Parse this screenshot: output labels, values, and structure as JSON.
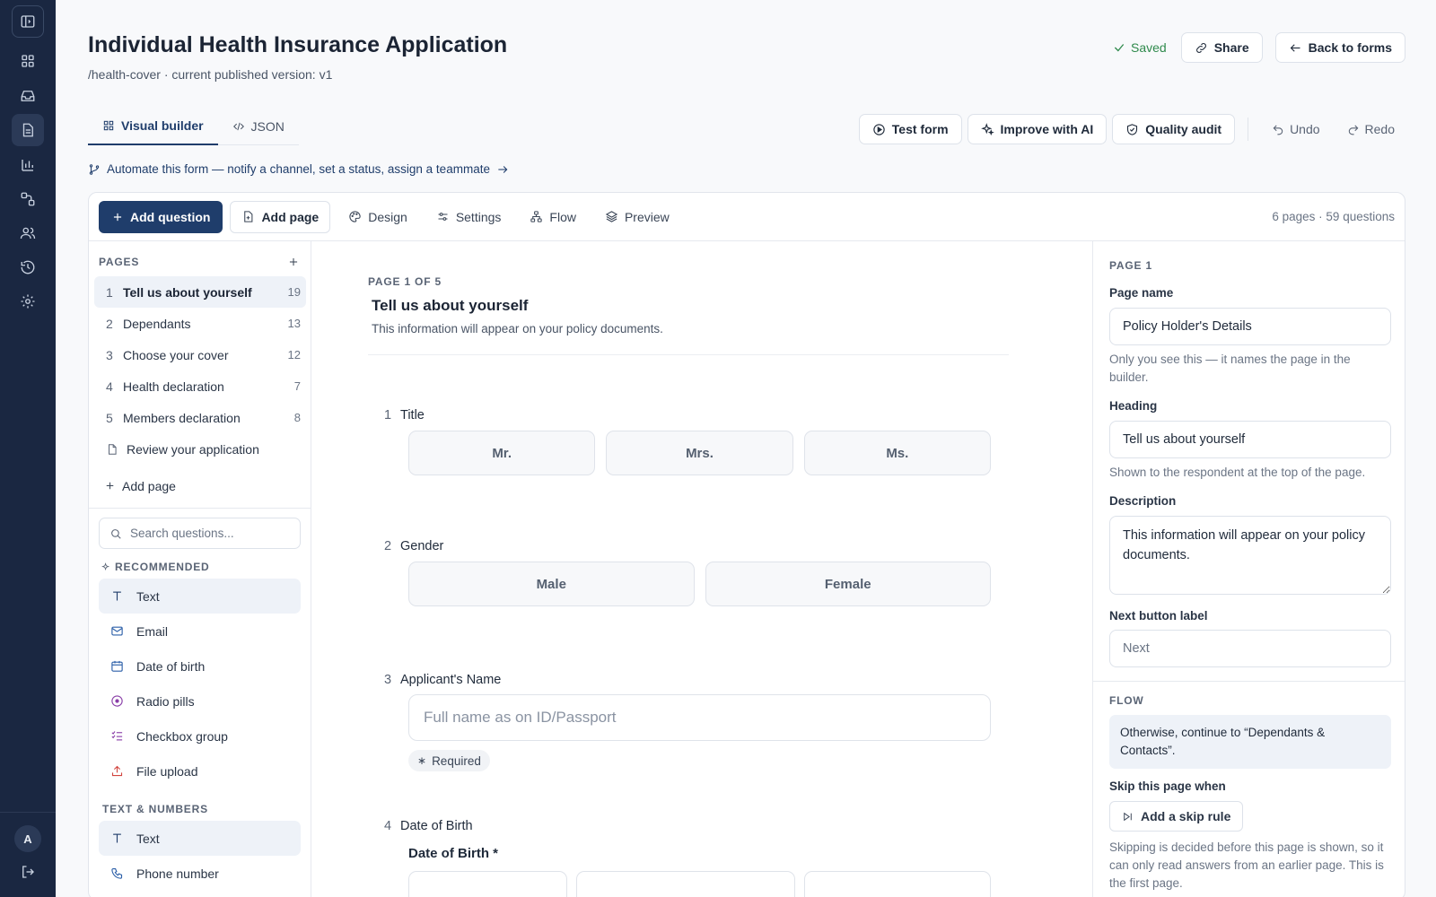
{
  "app": {
    "title": "Individual Health Insurance Application",
    "subtitle": "/health-cover · current published version: v1",
    "saved_label": "Saved",
    "share_label": "Share",
    "back_label": "Back to forms"
  },
  "rail": {
    "avatar": "A",
    "items": [
      "sidebar-toggle-icon",
      "grid-icon",
      "inbox-icon",
      "document-icon",
      "bar-chart-icon",
      "workflow-icon",
      "users-icon",
      "history-icon",
      "gear-icon"
    ],
    "active": "document-icon"
  },
  "tabs": [
    {
      "label": "Visual builder",
      "active": true
    },
    {
      "label": "JSON",
      "active": false
    }
  ],
  "actions": {
    "test_form": "Test form",
    "improve_ai": "Improve with AI",
    "quality_audit": "Quality audit",
    "undo": "Undo",
    "redo": "Redo"
  },
  "automate_link": "Automate this form — notify a channel, set a status, assign a teammate",
  "toolbar": {
    "add_question": "Add question",
    "add_page": "Add page",
    "design": "Design",
    "settings": "Settings",
    "flow": "Flow",
    "preview": "Preview",
    "summary": "6 pages · 59 questions"
  },
  "pages_panel": {
    "label": "PAGES",
    "items": [
      {
        "num": "1",
        "name": "Tell us about yourself",
        "count": "19",
        "active": true
      },
      {
        "num": "2",
        "name": "Dependants",
        "count": "13"
      },
      {
        "num": "3",
        "name": "Choose your cover",
        "count": "12"
      },
      {
        "num": "4",
        "name": "Health declaration",
        "count": "7"
      },
      {
        "num": "5",
        "name": "Members declaration",
        "count": "8"
      }
    ],
    "review_item": "Review your application",
    "add_page": "Add page"
  },
  "question_types": {
    "search_placeholder": "Search questions...",
    "recommended_label": "RECOMMENDED",
    "recommended": [
      "Text",
      "Email",
      "Date of birth",
      "Radio pills",
      "Checkbox group",
      "File upload"
    ],
    "text_numbers_label": "TEXT & NUMBERS",
    "text_numbers": [
      "Text",
      "Phone number"
    ]
  },
  "canvas": {
    "page_of": "PAGE 1 OF 5",
    "page_title": "Tell us about yourself",
    "page_desc": "This information will appear on your policy documents.",
    "questions": [
      {
        "num": "1",
        "label": "Title",
        "options": [
          "Mr.",
          "Mrs.",
          "Ms."
        ]
      },
      {
        "num": "2",
        "label": "Gender",
        "options": [
          "Male",
          "Female"
        ]
      },
      {
        "num": "3",
        "label": "Applicant's Name",
        "placeholder": "Full name as on ID/Passport",
        "badge": "Required"
      },
      {
        "num": "4",
        "label": "Date of Birth",
        "sub_label": "Date of Birth *"
      }
    ]
  },
  "props": {
    "section": "PAGE 1",
    "page_name_label": "Page name",
    "page_name_value": "Policy Holder's Details",
    "page_name_help": "Only you see this — it names the page in the builder.",
    "heading_label": "Heading",
    "heading_value": "Tell us about yourself",
    "heading_help": "Shown to the respondent at the top of the page.",
    "description_label": "Description",
    "description_value": "This information will appear on your policy documents.",
    "next_label": "Next button label",
    "next_placeholder": "Next",
    "flow_section": "FLOW",
    "flow_note": "Otherwise, continue to “Dependants & Contacts”.",
    "skip_label": "Skip this page when",
    "skip_button": "Add a skip rule",
    "skip_help": "Skipping is decided before this page is shown, so it can only read answers from an earlier page. This is the first page."
  },
  "colors": {
    "rail": "#1a2741",
    "primary": "#1f3d6b",
    "saved": "#2f8a4c"
  }
}
